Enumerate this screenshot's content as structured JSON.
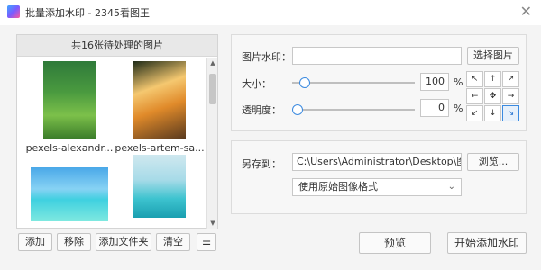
{
  "window": {
    "title": "批量添加水印 - 2345看图王",
    "close": "✕"
  },
  "file_list": {
    "header": "共16张待处理的图片",
    "items": [
      {
        "name": "pexels-alexandr..."
      },
      {
        "name": "pexels-artem-sa..."
      },
      {
        "name": ""
      },
      {
        "name": ""
      }
    ],
    "buttons": {
      "add": "添加",
      "remove": "移除",
      "add_folder": "添加文件夹",
      "clear": "清空",
      "list_view": "☰"
    }
  },
  "watermark": {
    "image_label": "图片水印：",
    "image_value": "",
    "select_image_button": "选择图片",
    "size_label": "大小：",
    "size_value": "100",
    "size_unit": "%",
    "size_level": 0.1,
    "opacity_label": "透明度：",
    "opacity_value": "0",
    "opacity_unit": "%",
    "opacity_level": 0.0,
    "position_grid": {
      "cells": [
        "↖",
        "↑",
        "↗",
        "←",
        "✥",
        "→",
        "↙",
        "↓",
        "↘"
      ],
      "selected_index": 8
    }
  },
  "output": {
    "save_to_label": "另存到：",
    "path_value": "C:\\Users\\Administrator\\Desktop\\图片",
    "browse_button": "浏览...",
    "format_value": "使用原始图像格式",
    "format_chevron": "⌄"
  },
  "actions": {
    "preview_button": "预览",
    "start_button": "开始添加水印"
  }
}
